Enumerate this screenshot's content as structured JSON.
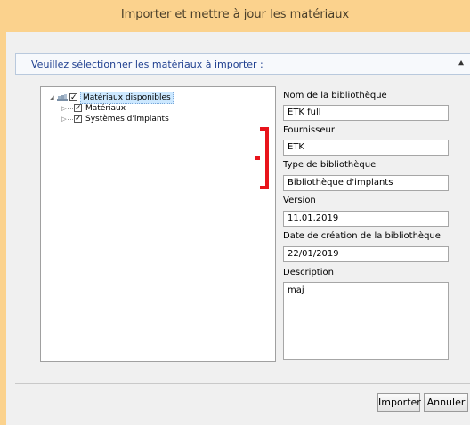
{
  "window": {
    "title": "Importer et mettre à jour les matériaux"
  },
  "section": {
    "label": "Veuillez sélectionner les matériaux à importer :",
    "chevron_icon": "double-chevron-up-icon"
  },
  "tree": {
    "root": {
      "label": "Matériaux disponibles",
      "checked": true,
      "expanded": true,
      "icon": "library-icon"
    },
    "children": [
      {
        "label": "Matériaux",
        "checked": true,
        "expanded": false
      },
      {
        "label": "Systèmes d'implants",
        "checked": true,
        "expanded": false
      }
    ]
  },
  "fields": {
    "library_name": {
      "label": "Nom de la bibliothèque",
      "value": "ETK full"
    },
    "supplier": {
      "label": "Fournisseur",
      "value": "ETK"
    },
    "library_type": {
      "label": "Type de bibliothèque",
      "value": "Bibliothèque d'implants"
    },
    "version": {
      "label": "Version",
      "value": "11.01.2019"
    },
    "creation_date": {
      "label": "Date de création de la bibliothèque",
      "value": "22/01/2019"
    },
    "description": {
      "label": "Description",
      "value": "maj"
    }
  },
  "buttons": {
    "import": "Importer",
    "cancel": "Annuler"
  },
  "colors": {
    "titlebar": "#fbd28d",
    "section_text": "#1f3f8f",
    "annotation": "#e8141b"
  }
}
